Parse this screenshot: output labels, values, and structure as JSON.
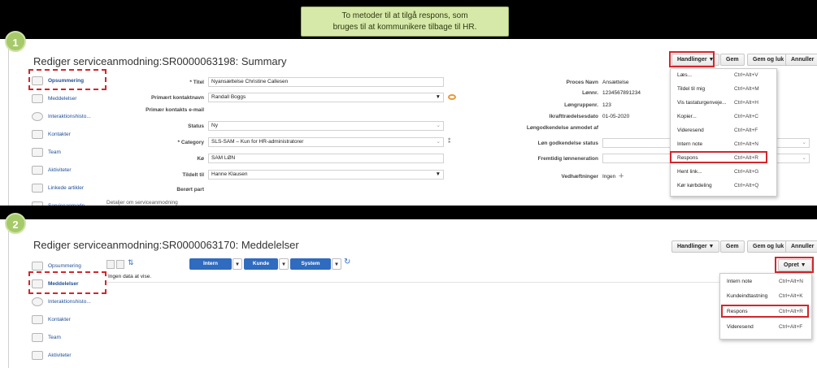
{
  "callout": {
    "line1": "To metoder til at tilgå respons, som",
    "line2": "bruges til at kommunikere tilbage til HR."
  },
  "steps": {
    "one": "1",
    "two": "2"
  },
  "panel1": {
    "title": "Rediger serviceanmodning:SR0000063198: Summary",
    "actions": {
      "handlinger": "Handlinger ▼",
      "gem": "Gem",
      "gem_og_luk": "Gem og luk",
      "annuller": "Annuller"
    },
    "sidebar": [
      "Opsummering",
      "Meddelelser",
      "Interaktionshisto...",
      "Kontakter",
      "Team",
      "Aktiviteter",
      "Linkede artikler",
      "Serviceanmodn..."
    ],
    "left_fields": {
      "titel_label": "* Titel",
      "titel_value": "Nyansættelse Christine Callesen",
      "primaer_label": "Primært kontaktnavn",
      "primaer_value": "Randall Boggs",
      "email_label": "Primær kontakts e-mail",
      "status_label": "Status",
      "status_value": "Ny",
      "category_label": "* Category",
      "category_value": "SLS-SAM – Kun for HR-administratorer",
      "koe_label": "Kø",
      "koe_value": "SAM LØN",
      "tildelt_label": "Tildelt til",
      "tildelt_value": "Hanne Klausen",
      "berort_label": "Berørt part"
    },
    "right_fields": {
      "proces_label": "Proces Navn",
      "proces_value": "Ansættelse",
      "loennr_label": "Lønnr.",
      "loennr_value": "1234567891234",
      "loengruppe_label": "Løngruppenr.",
      "loengruppe_value": "123",
      "ikraft_label": "Ikrafttrædelsesdato",
      "ikraft_value": "01-05-2020",
      "godk_anmodet_label": "Løngodkendelse anmodet af",
      "godk_status_label": "Løn godkendelse status",
      "fremtidig_label": "Fremtidig lønneneration",
      "vedh_label": "Vedhæftninger",
      "vedh_value": "Ingen"
    },
    "section_footer": "Detaljer om serviceanmodning",
    "menu": [
      {
        "label": "Læs...",
        "shortcut": "Ctrl+Alt+V"
      },
      {
        "label": "Tildel til mig",
        "shortcut": "Ctrl+Alt+M"
      },
      {
        "label": "Vis tastaturgenveje...",
        "shortcut": "Ctrl+Alt+H"
      },
      {
        "label": "Kopier...",
        "shortcut": "Ctrl+Alt+C"
      },
      {
        "label": "Videresend",
        "shortcut": "Ctrl+Alt+F"
      },
      {
        "label": "Intern note",
        "shortcut": "Ctrl+Alt+N"
      },
      {
        "label": "Respons",
        "shortcut": "Ctrl+Alt+R"
      },
      {
        "label": "Hent link...",
        "shortcut": "Ctrl+Alt+G"
      },
      {
        "label": "Kør kørbdeling",
        "shortcut": "Ctrl+Alt+Q"
      }
    ]
  },
  "panel2": {
    "title": "Rediger serviceanmodning:SR0000063170: Meddelelser",
    "actions": {
      "handlinger": "Handlinger ▼",
      "gem": "Gem",
      "gem_og_luk": "Gem og luk",
      "annuller": "Annuller",
      "opret": "Opret ▼"
    },
    "sidebar": [
      "Opsummering",
      "Meddelelser",
      "Interaktionshisto...",
      "Kontakter",
      "Team",
      "Aktiviteter"
    ],
    "filters": {
      "intern": "Intern",
      "kunde": "Kunde",
      "system": "System"
    },
    "empty_text": "Ingen data at vise.",
    "menu": [
      {
        "label": "Intern note",
        "shortcut": "Ctrl+Alt+N"
      },
      {
        "label": "Kundeindtastning",
        "shortcut": "Ctrl+Alt+K"
      },
      {
        "label": "Respons",
        "shortcut": "Ctrl+Alt+R"
      },
      {
        "label": "Videresend",
        "shortcut": "Ctrl+Alt+F"
      }
    ]
  },
  "colors": {
    "accent_red": "#d3262b",
    "link_blue": "#1f4e99",
    "callout_green": "#d7e9a8",
    "step_green": "#a6c96a",
    "segment_blue": "#2f6bbf"
  }
}
